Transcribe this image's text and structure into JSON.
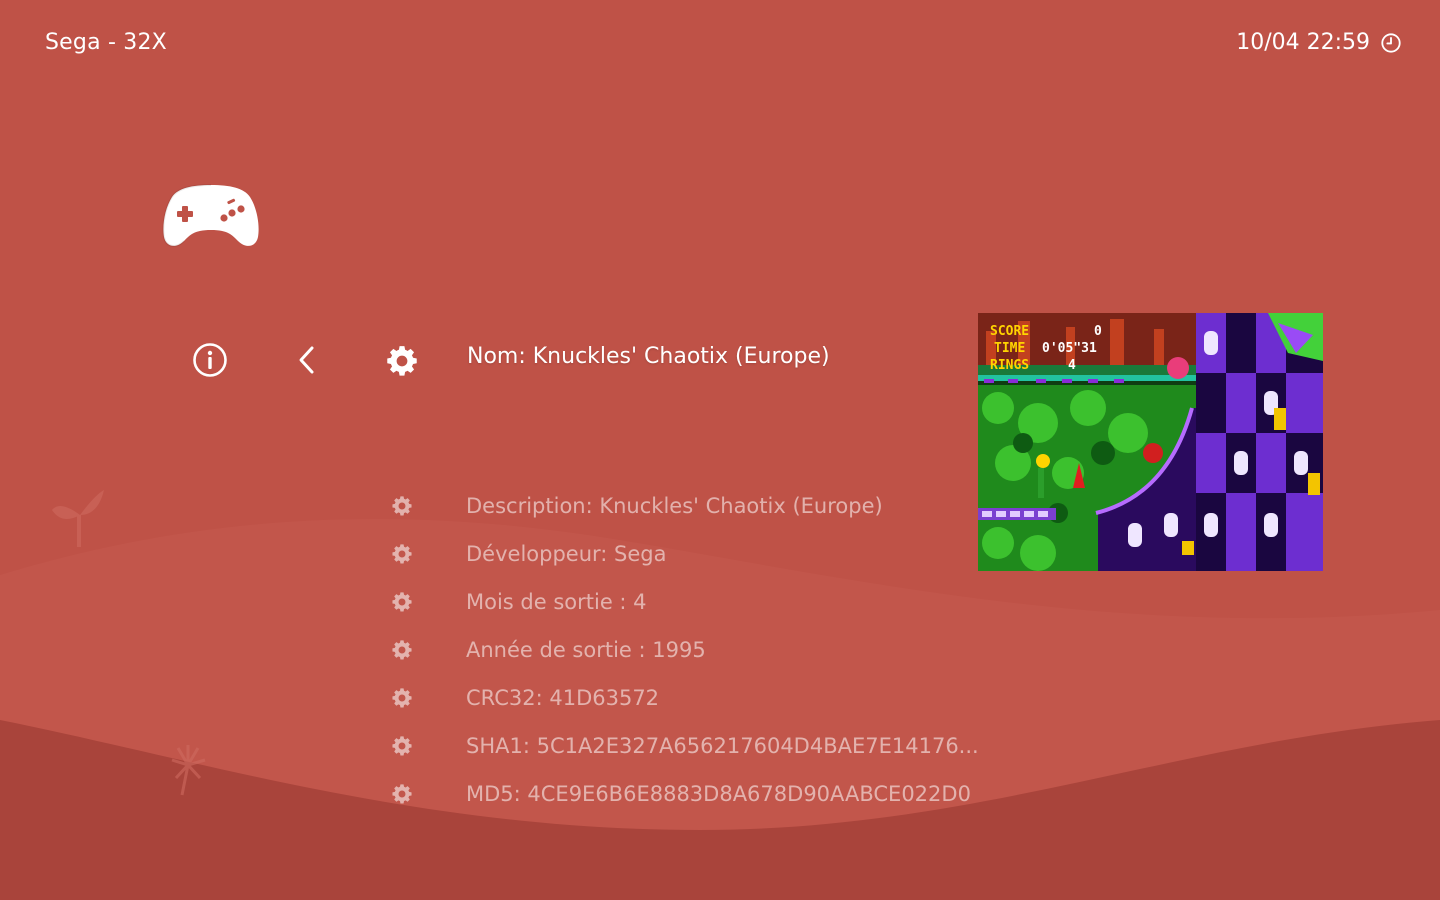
{
  "header": {
    "system_name": "Sega - 32X",
    "datetime": "10/04 22:59",
    "clock_icon": "clock-icon"
  },
  "system_icon": "gamepad-icon",
  "toolbar": {
    "info_icon": "info-icon",
    "back_icon": "chevron-left-icon",
    "settings_icon": "gear-icon"
  },
  "game": {
    "name_line": "Nom: Knuckles' Chaotix (Europe)"
  },
  "metadata": [
    {
      "text": "Description: Knuckles' Chaotix (Europe)",
      "icon": "gear-icon"
    },
    {
      "text": "Développeur: Sega",
      "icon": "gear-icon"
    },
    {
      "text": "Mois de sortie : 4",
      "icon": "gear-icon"
    },
    {
      "text": "Année de sortie : 1995",
      "icon": "gear-icon"
    },
    {
      "text": "CRC32: 41D63572",
      "icon": "gear-icon"
    },
    {
      "text": "SHA1: 5C1A2E327A656217604D4BAE7E14176...",
      "icon": "gear-icon"
    },
    {
      "text": "MD5: 4CE9E6B6E8883D8A678D90AABCE022D0",
      "icon": "gear-icon"
    }
  ],
  "screenshot_hud": {
    "score_label": "SCORE",
    "score_value": "0",
    "time_label": "TIME",
    "time_value": "0'05\"31",
    "rings_label": "RINGS",
    "rings_value": "4"
  },
  "colors": {
    "background": "#bf5247",
    "wave_light": "#c55a4e",
    "wave_dark": "#a9443b",
    "text": "#ffffff"
  }
}
